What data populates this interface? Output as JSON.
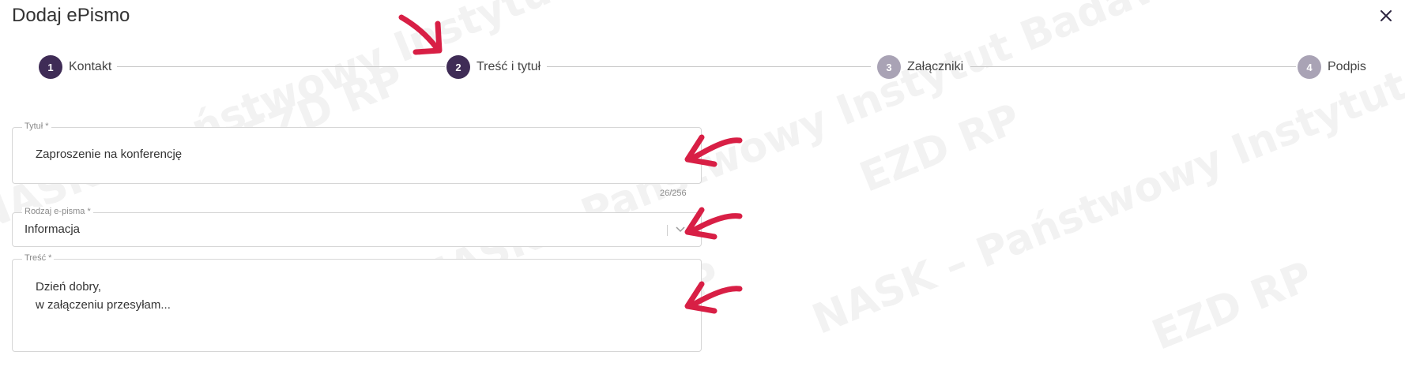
{
  "dialog": {
    "title": "Dodaj ePismo"
  },
  "watermark": {
    "text": "NASK – Państwowy Instytut Badawczy",
    "logo": "EZD RP"
  },
  "stepper": {
    "steps": [
      {
        "number": "1",
        "label": "Kontakt",
        "state": "done",
        "color": "#3f2c56"
      },
      {
        "number": "2",
        "label": "Treść i tytuł",
        "state": "active",
        "color": "#3f2c56"
      },
      {
        "number": "3",
        "label": "Załączniki",
        "state": "pending",
        "color": "#a9a3b5"
      },
      {
        "number": "4",
        "label": "Podpis",
        "state": "pending",
        "color": "#a9a3b5"
      }
    ]
  },
  "form": {
    "title_field": {
      "label": "Tytuł *",
      "value": "Zaproszenie na konferencję",
      "counter": "26/256"
    },
    "type_field": {
      "label": "Rodzaj e-pisma *",
      "value": "Informacja",
      "icon": "chevron-down-icon"
    },
    "content_field": {
      "label": "Treść *",
      "line1": "Dzień dobry,",
      "line2": "w załączeniu przesyłam..."
    }
  },
  "annotations": {
    "arrow_color": "#d81f45"
  }
}
